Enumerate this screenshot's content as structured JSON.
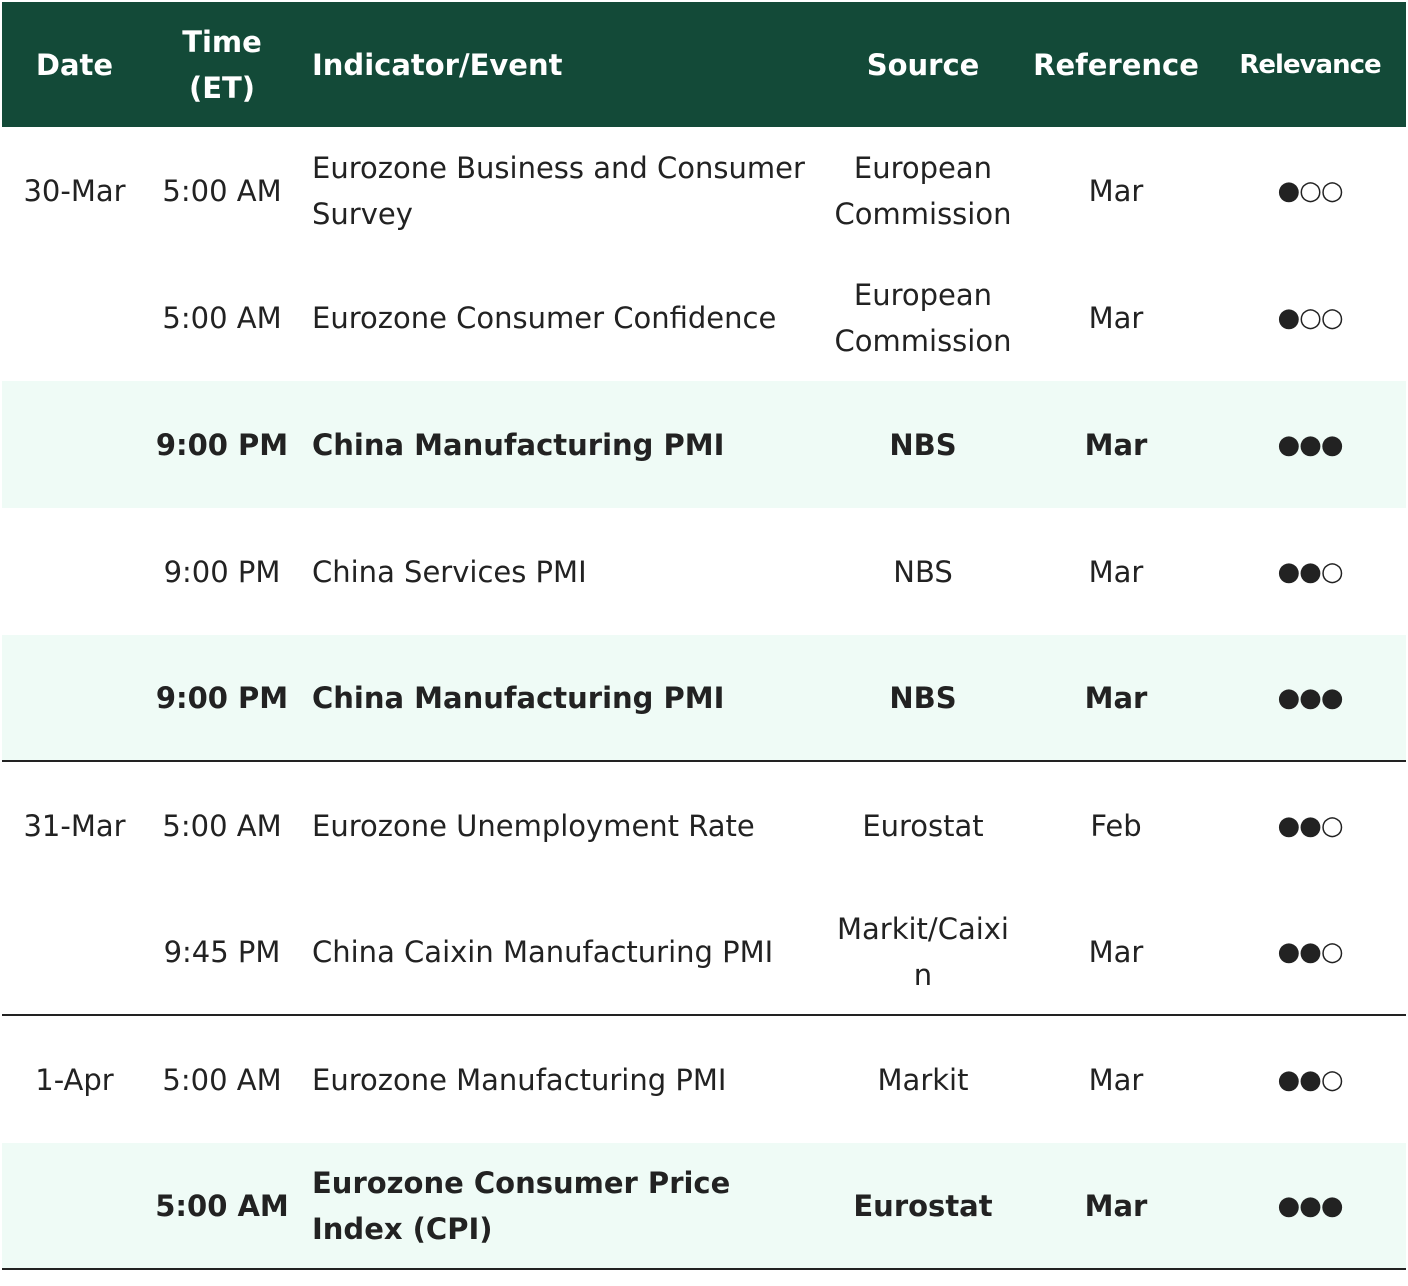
{
  "header": {
    "date": "Date",
    "time": "Time (ET)",
    "indicator": "Indicator/Event",
    "source": "Source",
    "reference": "Reference",
    "relevance": "Relevance"
  },
  "rows": [
    {
      "date": "30-Mar",
      "time": "5:00 AM",
      "indicator": "Eurozone Business and Consumer Survey",
      "source": "European Commission",
      "reference": "Mar",
      "relevance": "●○○"
    },
    {
      "date": "",
      "time": "5:00 AM",
      "indicator": "Eurozone Consumer Confidence",
      "source": "European Commission",
      "reference": "Mar",
      "relevance": "●○○"
    },
    {
      "date": "",
      "time": "9:00 PM",
      "indicator": "China Manufacturing PMI",
      "source": "NBS",
      "reference": "Mar",
      "relevance": "●●●"
    },
    {
      "date": "",
      "time": "9:00 PM",
      "indicator": "China Services PMI",
      "source": "NBS",
      "reference": "Mar",
      "relevance": "●●○"
    },
    {
      "date": "",
      "time": "9:00 PM",
      "indicator": "China Manufacturing PMI",
      "source": "NBS",
      "reference": "Mar",
      "relevance": "●●●"
    },
    {
      "date": "31-Mar",
      "time": "5:00 AM",
      "indicator": "Eurozone Unemployment Rate",
      "source": "Eurostat",
      "reference": "Feb",
      "relevance": "●●○"
    },
    {
      "date": "",
      "time": "9:45 PM",
      "indicator": "China Caixin Manufacturing PMI",
      "source": "Markit/Caixin",
      "reference": "Mar",
      "relevance": "●●○"
    },
    {
      "date": "1-Apr",
      "time": "5:00 AM",
      "indicator": "Eurozone Manufacturing PMI",
      "source": "Markit",
      "reference": "Mar",
      "relevance": "●●○"
    },
    {
      "date": "",
      "time": "5:00 AM",
      "indicator": "Eurozone Consumer Price Index (CPI)",
      "source": "Eurostat",
      "reference": "Mar",
      "relevance": "●●●"
    }
  ]
}
